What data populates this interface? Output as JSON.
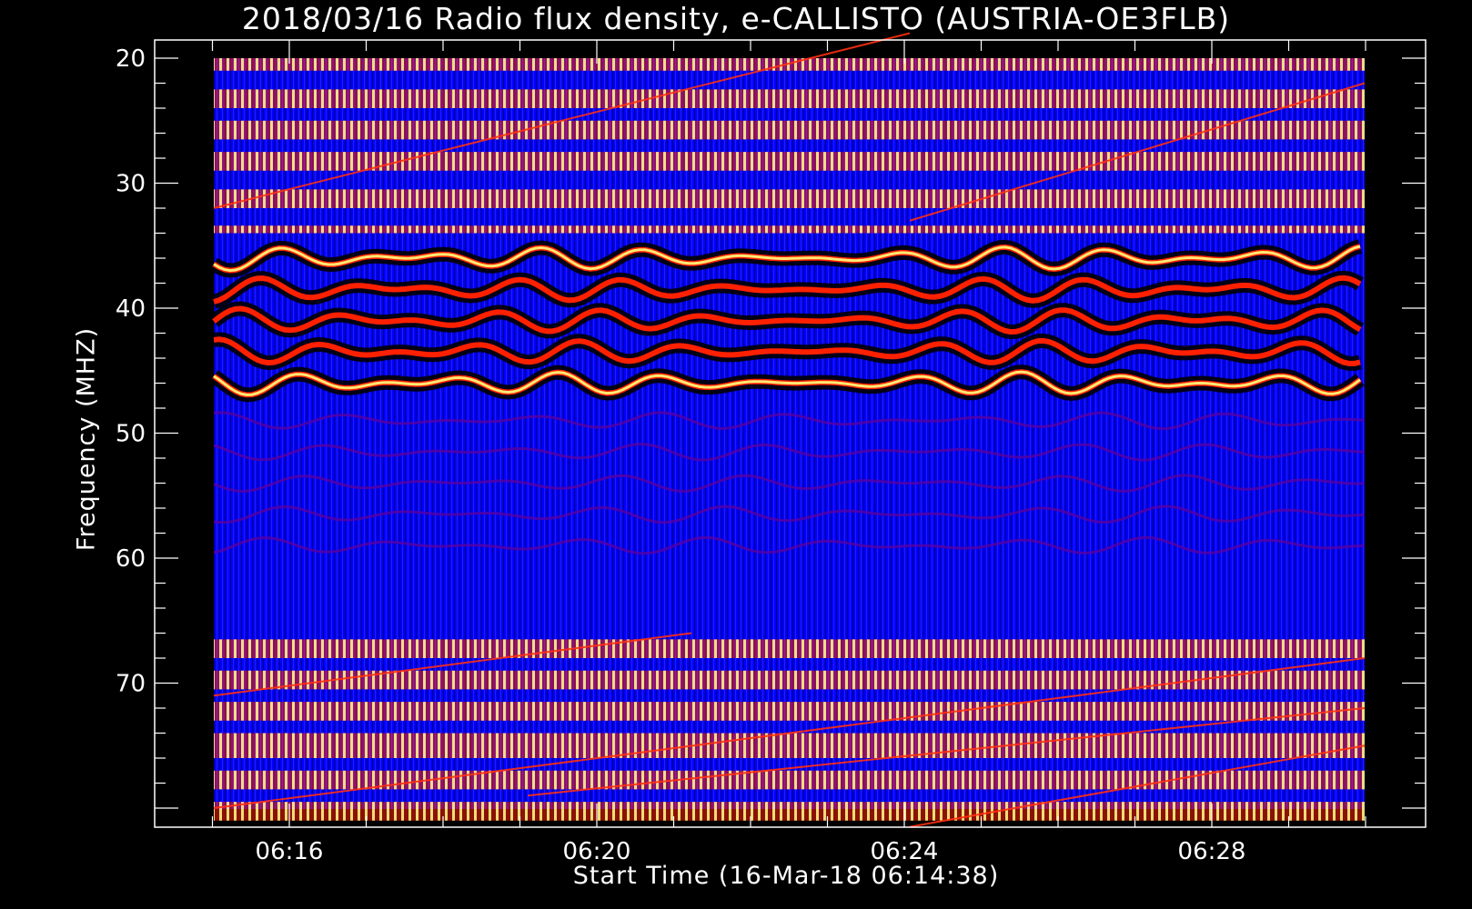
{
  "chart_data": {
    "type": "heatmap",
    "title": "2018/03/16  Radio flux density, e-CALLISTO (AUSTRIA-OE3FLB)",
    "xlabel": "Start Time (16-Mar-18 06:14:38)",
    "ylabel": "Frequency (MHZ)",
    "x_ticks": [
      "06:16",
      "06:20",
      "06:24",
      "06:28"
    ],
    "y_ticks": [
      20,
      30,
      40,
      50,
      60,
      70
    ],
    "ylim": [
      81.5,
      19
    ],
    "colormap": [
      "#000000",
      "#0000ff",
      "#ff2000",
      "#ffff80"
    ],
    "colors": {
      "background": "#000000",
      "axes": "#ffffff",
      "low": "#0000ff",
      "mid": "#ff2000",
      "high": "#ffff80"
    }
  }
}
